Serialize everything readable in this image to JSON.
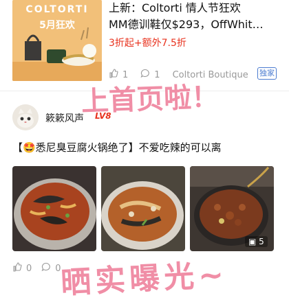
{
  "top_post": {
    "image_brand": "COLTORTI",
    "image_subtitle": "5月狂欢",
    "title_line1": "上新：Coltorti 情人节狂欢",
    "title_line2": "MM德训鞋仅$293，OffWhit…",
    "price": "3折起+额外7.5折",
    "likes": "1",
    "comments": "1",
    "source": "Coltorti Boutique",
    "tag": "独家"
  },
  "overlay": {
    "text_top": "上首页啦！",
    "text_bottom": "晒实曝光~"
  },
  "post": {
    "username": "簌簌风声",
    "level": "LV8",
    "title": "【🤩悉尼臭豆腐火锅绝了】不爱吃辣的可以离",
    "image_count": "5",
    "likes": "0",
    "comments": "0"
  },
  "colors": {
    "accent": "#e8321e",
    "handwriting": "#f08ea6",
    "tag": "#4a7bd0"
  }
}
